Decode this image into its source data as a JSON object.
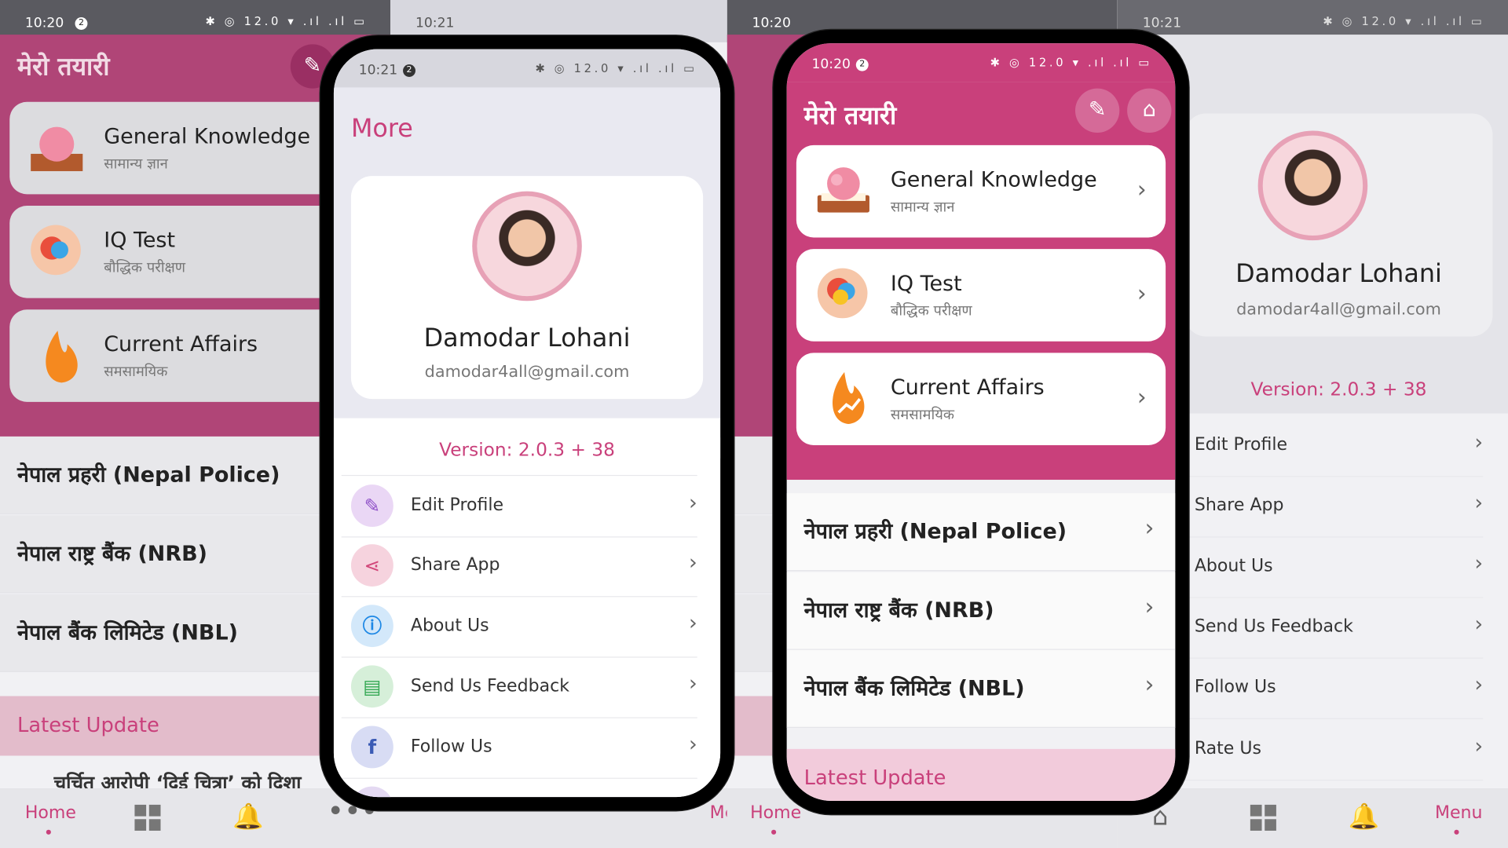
{
  "status": {
    "time_a": "10:20",
    "time_b": "10:21",
    "badge": "2",
    "icons": "✱ ◎ 12.0 ▾ .ıl .ıl ▭"
  },
  "home": {
    "title": "मेरो तयारी",
    "cards": [
      {
        "title": "General Knowledge",
        "subtitle": "सामान्य ज्ञान"
      },
      {
        "title": "IQ Test",
        "subtitle": "बौद्धिक परीक्षण"
      },
      {
        "title": "Current Affairs",
        "subtitle": "समसामयिक"
      }
    ],
    "exams": [
      "नेपाल प्रहरी (Nepal Police)",
      "नेपाल राष्ट्र बैंक (NRB)",
      "नेपाल बैंक लिमिटेड (NBL)"
    ],
    "latest_label": "Latest Update",
    "news_snippet": "चर्चित आरोपी ‘दिई चित्रा’ को दिशा"
  },
  "tabs": {
    "home": "Home",
    "menu": "Menu"
  },
  "more": {
    "title": "More",
    "name": "Damodar Lohani",
    "email": "damodar4all@gmail.com",
    "version": "Version: 2.0.3 + 38",
    "items": [
      "Edit Profile",
      "Share App",
      "About Us",
      "Send Us Feedback",
      "Follow Us",
      "Rate Us"
    ]
  },
  "colors": {
    "brand": "#c9407b",
    "latest_bg": "#f2cbdb"
  },
  "icon_names": [
    "edit-icon",
    "bank-icon",
    "share-icon",
    "info-icon",
    "feedback-icon",
    "facebook-icon",
    "star-icon",
    "bell-icon",
    "grid-icon",
    "more-icon",
    "home-icon",
    "chevron-right-icon"
  ]
}
